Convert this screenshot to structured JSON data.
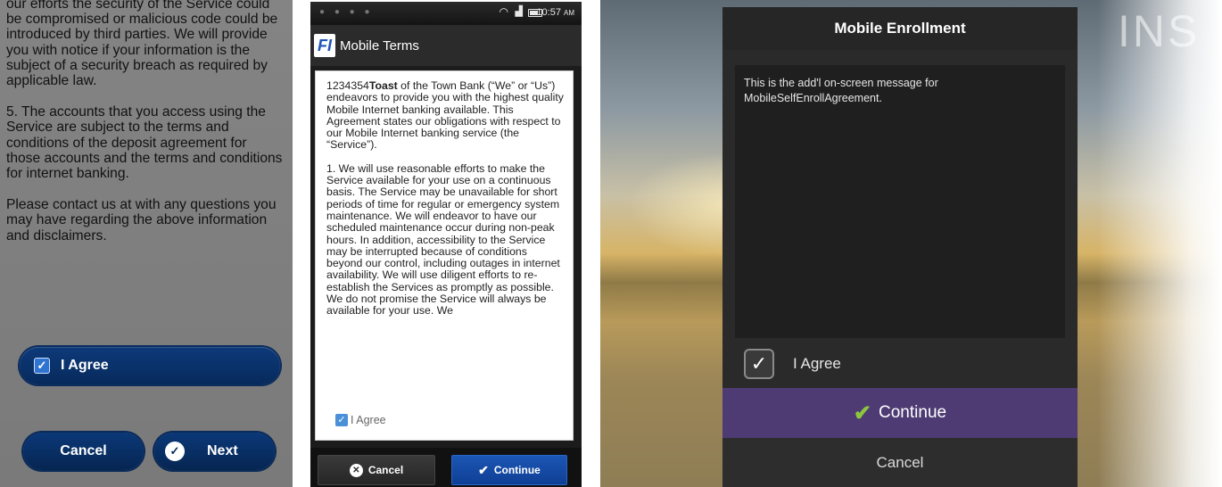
{
  "panel1": {
    "paragraphs": [
      "our efforts the security of the Service could be compromised or malicious code could be introduced by third parties. We will provide you with notice if your information is the subject of a security breach as required by applicable law.",
      "5. The accounts that you access using the Service are subject to the terms and conditions of the deposit agreement for those accounts and the terms and conditions for internet banking.",
      "Please contact us at with any questions you may have regarding the above information and disclaimers."
    ],
    "agree_label": "I Agree",
    "cancel_label": "Cancel",
    "next_label": "Next",
    "accent": "#0b3878"
  },
  "panel2": {
    "status_time": "10:57",
    "status_ampm": "AM",
    "app_logo": "FI",
    "app_title": "Mobile Terms",
    "intro_prefix": "1234354",
    "intro_bold": "Toast",
    "intro_rest": " of the Town Bank (“We” or “Us”) endeavors to provide you with the highest quality Mobile Internet banking available. This Agreement states our obligations with respect to our Mobile Internet banking service (the “Service”).",
    "paragraph1": "1. We will use reasonable efforts to make the Service available for your use on a continuous basis. The Service may be unavailable for short periods of time for regular or emergency system maintenance. We will endeavor to have our scheduled maintenance occur during non-peak hours. In addition, accessibility to the Service may be interrupted because of conditions beyond our control, including outages in internet availability. We will use diligent efforts to re-establish the Services as promptly as possible. We do not promise the Service will always be available for your use. We",
    "agree_label": "I Agree",
    "cancel_label": "Cancel",
    "continue_label": "Continue",
    "accent": "#1b56b5"
  },
  "panel3": {
    "background_text": "INS",
    "dialog_title": "Mobile Enrollment",
    "message": "This is the add'l on-screen message for MobileSelfEnrollAgreement.",
    "agree_label": "I Agree",
    "continue_label": "Continue",
    "cancel_label": "Cancel",
    "accent": "#4e3b73",
    "check_color": "#8cc63f"
  }
}
